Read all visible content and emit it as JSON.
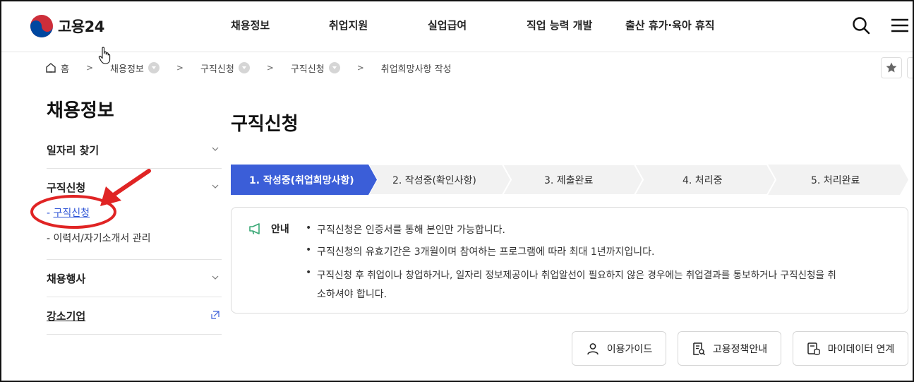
{
  "header": {
    "logo_text": "고용24",
    "nav": [
      "채용정보",
      "취업지원",
      "실업급여",
      "직업 능력 개발",
      "출산 휴가·육아 휴직"
    ]
  },
  "breadcrumb": {
    "home": "홈",
    "items": [
      "채용정보",
      "구직신청",
      "구직신청",
      "취업희망사항 작성"
    ]
  },
  "sidebar": {
    "title": "채용정보",
    "sections": [
      {
        "label": "일자리 찾기"
      },
      {
        "label": "구직신청",
        "subitems": [
          {
            "prefix": "- ",
            "label": "구직신청"
          },
          {
            "prefix": "",
            "label": "- 이력서/자기소개서 관리"
          }
        ]
      },
      {
        "label": "채용행사"
      },
      {
        "label": "강소기업"
      }
    ]
  },
  "main": {
    "title": "구직신청",
    "steps": [
      "1. 작성중(취업희망사항)",
      "2. 작성중(확인사항)",
      "3. 제출완료",
      "4. 처리중",
      "5. 처리완료"
    ],
    "active_step": 1,
    "notice": {
      "heading": "안내",
      "bullets": [
        "구직신청은 인증서를 통해 본인만 가능합니다.",
        "구직신청의 유효기간은 3개월이며 참여하는 프로그램에 따라 최대 1년까지입니다.",
        "구직신청 후 취업이나 창업하거나, 일자리 정보제공이나 취업알선이 필요하지 않은 경우에는 취업결과를 통보하거나 구직신청을 취"
      ],
      "bullet3_cont": "소하셔야 합니다."
    },
    "buttons": [
      "이용가이드",
      "고용정책안내",
      "마이데이터 연계"
    ]
  },
  "colors": {
    "accent": "#3b5ed8",
    "step_inactive": "#f2f2f2",
    "notice_icon": "#3aa876",
    "annotation": "#e02424"
  }
}
